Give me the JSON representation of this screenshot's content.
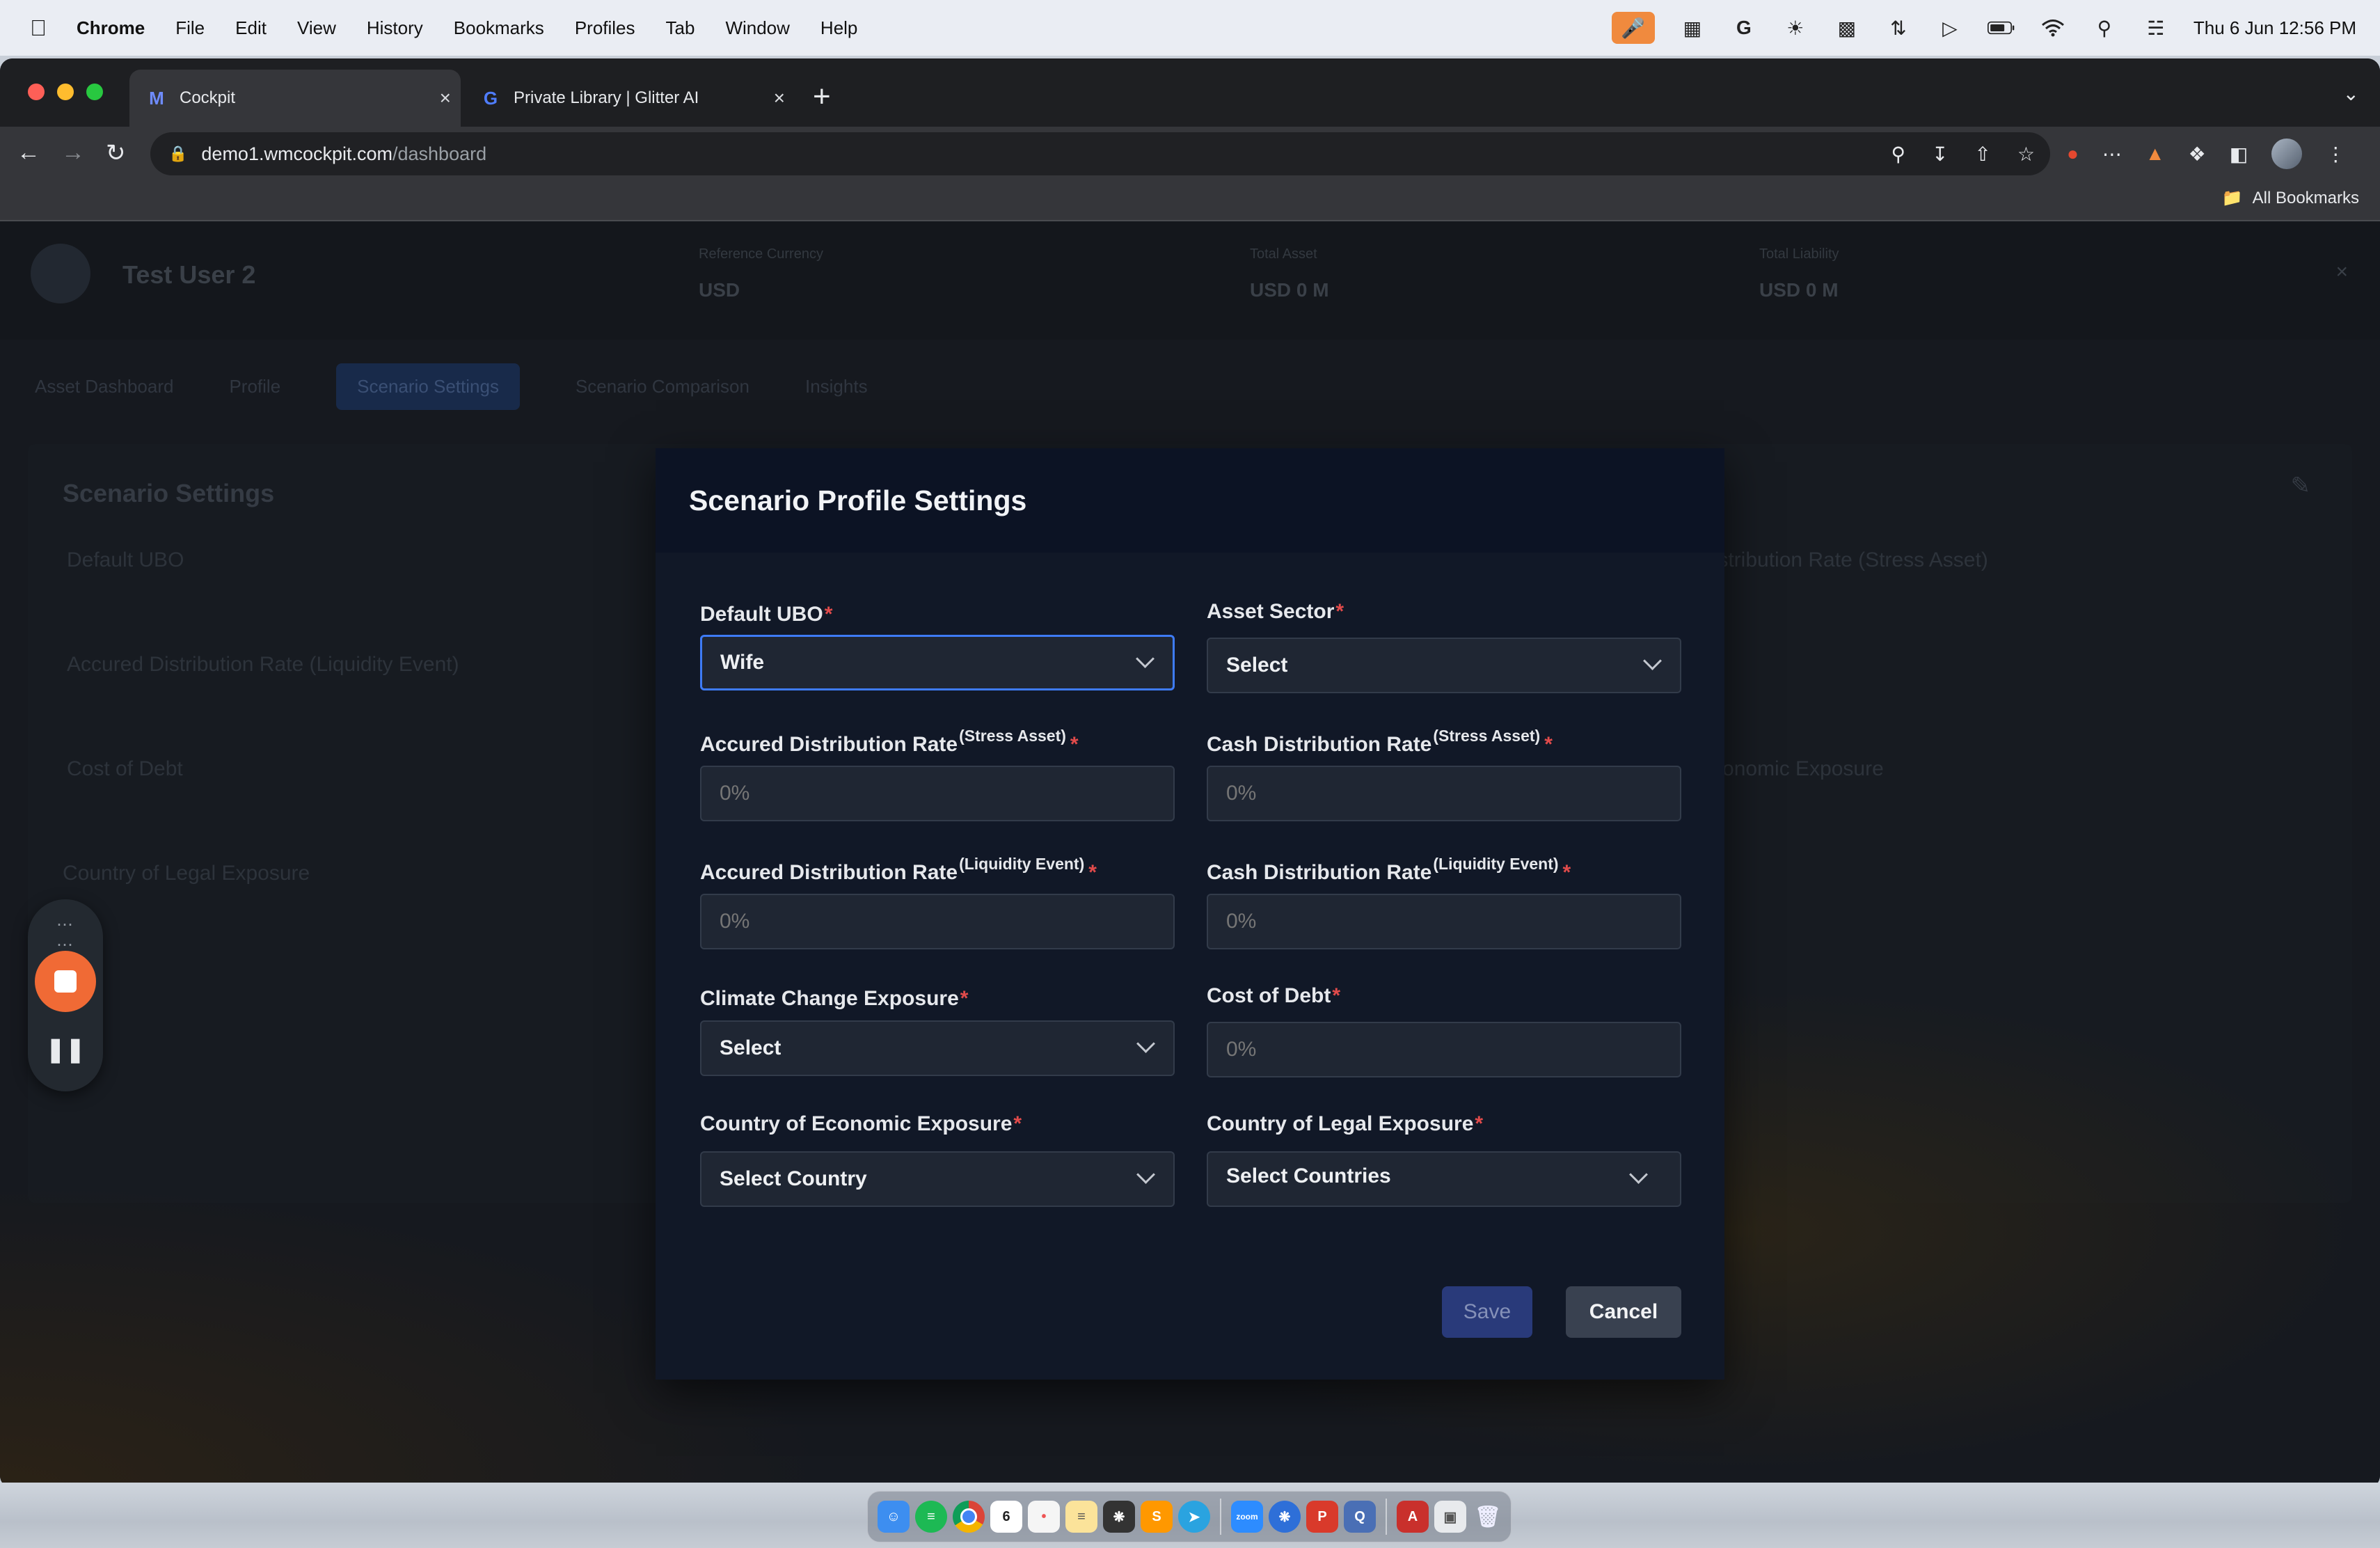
{
  "menubar": {
    "app_name": "Chrome",
    "menus": [
      "File",
      "Edit",
      "View",
      "History",
      "Bookmarks",
      "Profiles",
      "Tab",
      "Window",
      "Help"
    ],
    "clock": "Thu 6 Jun  12:56 PM",
    "status_icons": [
      "microphone-icon",
      "activity-monitor-icon",
      "grammarly-icon",
      "sun-icon",
      "layout-icon",
      "network-icon",
      "play-icon",
      "battery-icon",
      "wifi-icon",
      "search-icon",
      "control-center-icon"
    ]
  },
  "browser": {
    "tabs": [
      {
        "title": "Cockpit",
        "favicon": "cockpit-icon",
        "active": true
      },
      {
        "title": "Private Library | Glitter AI",
        "favicon": "glitter-icon",
        "active": false
      }
    ],
    "url_host": "demo1.wmcockpit.com",
    "url_path": "/dashboard",
    "bookmarks_label": "All Bookmarks"
  },
  "background": {
    "user_name": "Test User 2",
    "stats": [
      {
        "label": "Reference Currency",
        "value": "USD"
      },
      {
        "label": "Total Asset",
        "value": "USD 0 M"
      },
      {
        "label": "Total Liability",
        "value": "USD 0 M"
      }
    ],
    "tabs": [
      "Asset Dashboard",
      "Profile",
      "Scenario Settings",
      "Scenario Comparison",
      "Insights"
    ],
    "card_title": "Scenario Settings",
    "labels": [
      "Default UBO",
      "Accured Distribution Rate (Liquidity Event)",
      "Cost of Debt",
      "Country of Legal Exposure",
      "Distribution Rate (Stress Asset)",
      "Economic Exposure"
    ]
  },
  "modal": {
    "title": "Scenario Profile Settings",
    "fields": {
      "default_ubo": {
        "label": "Default UBO",
        "value": "Wife"
      },
      "asset_sector": {
        "label": "Asset Sector",
        "value": "Select"
      },
      "accured_stress": {
        "label": "Accured Distribution Rate",
        "sup": "(Stress Asset)",
        "placeholder": "0%"
      },
      "cash_stress": {
        "label": "Cash Distribution Rate",
        "sup": "(Stress Asset)",
        "placeholder": "0%"
      },
      "accured_liquidity": {
        "label": "Accured Distribution Rate",
        "sup": "(Liquidity Event)",
        "placeholder": "0%"
      },
      "cash_liquidity": {
        "label": "Cash Distribution Rate",
        "sup": "(Liquidity Event)",
        "placeholder": "0%"
      },
      "climate": {
        "label": "Climate Change Exposure",
        "value": "Select"
      },
      "cost_of_debt": {
        "label": "Cost of Debt",
        "placeholder": "0%"
      },
      "economic_country": {
        "label": "Country of Economic Exposure",
        "value": "Select Country"
      },
      "legal_country": {
        "label": "Country of Legal Exposure",
        "value": "Select Countries"
      }
    },
    "required_mark": "*",
    "save_label": "Save",
    "cancel_label": "Cancel"
  },
  "dock": {
    "apps": [
      "finder-icon",
      "spotify-icon",
      "chrome-icon",
      "calendar-icon",
      "reminders-icon",
      "notes-icon",
      "chatgpt-icon",
      "sublime-icon",
      "telegram-icon",
      "zoom-icon",
      "settings-icon",
      "pdf-expert-icon",
      "quicktime-icon",
      "acrobat-icon",
      "preview-icon",
      "trash-icon"
    ],
    "calendar_day": "6",
    "zoom_label": "zoom"
  },
  "colors": {
    "accent": "#3e7bf6",
    "required": "#e24b4b",
    "recorder_stop": "#f06a35",
    "modal_bg": "#111827"
  }
}
